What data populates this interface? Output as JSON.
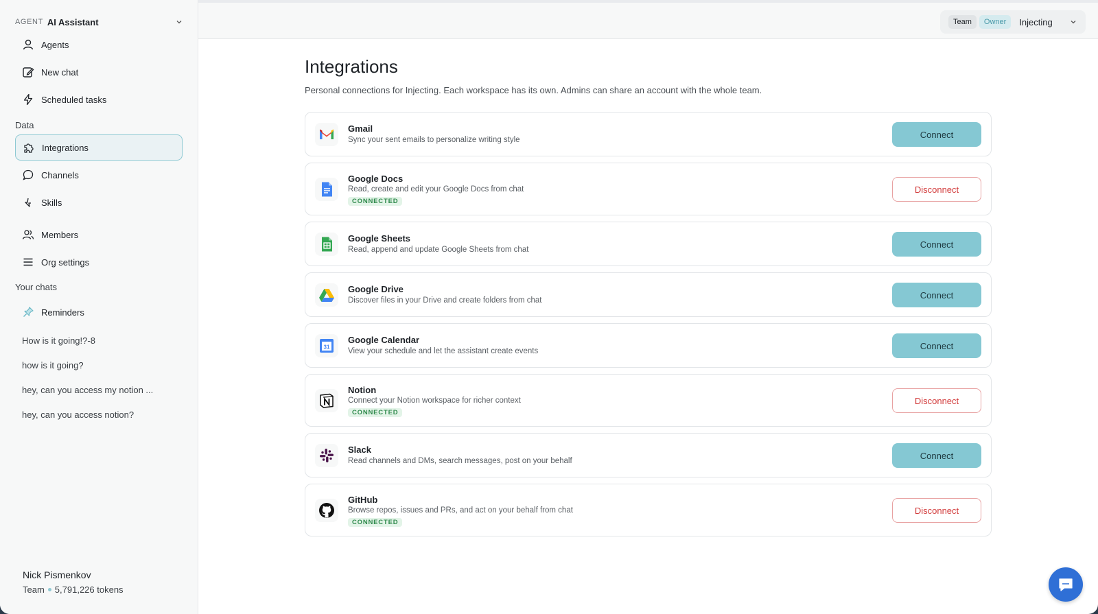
{
  "sidebar": {
    "agent_tag": "AGENT",
    "agent_name": "AI Assistant",
    "nav_top": [
      {
        "label": "Agents",
        "icon": "user-icon"
      },
      {
        "label": "New chat",
        "icon": "edit-icon"
      },
      {
        "label": "Scheduled tasks",
        "icon": "lightning-icon"
      }
    ],
    "data_label": "Data",
    "nav_data": [
      {
        "label": "Integrations",
        "icon": "puzzle-icon",
        "active": true
      },
      {
        "label": "Channels",
        "icon": "chat-bubble-icon"
      },
      {
        "label": "Skills",
        "icon": "sparkle-icon"
      }
    ],
    "nav_org": [
      {
        "label": "Members",
        "icon": "users-icon"
      },
      {
        "label": "Org settings",
        "icon": "menu-icon"
      }
    ],
    "chats_label": "Your chats",
    "reminders_label": "Reminders",
    "chats": [
      "How is it going!?-8",
      "how is it going?",
      "hey, can you access my notion ...",
      "hey, can you access notion?"
    ],
    "user": {
      "name": "Nick Pismenkov",
      "plan": "Team",
      "tokens": "5,791,226 tokens"
    }
  },
  "topbar": {
    "team_pill": "Team",
    "owner_pill": "Owner",
    "workspace": "Injecting"
  },
  "main": {
    "title": "Integrations",
    "description": "Personal connections for Injecting. Each workspace has its own. Admins can share an account with the whole team.",
    "connected_label": "CONNECTED",
    "integrations": [
      {
        "name": "Gmail",
        "desc": "Sync your sent emails to personalize writing style",
        "connected": false,
        "action": "Connect",
        "icon": "gmail-icon"
      },
      {
        "name": "Google Docs",
        "desc": "Read, create and edit your Google Docs from chat",
        "connected": true,
        "action": "Disconnect",
        "icon": "google-docs-icon"
      },
      {
        "name": "Google Sheets",
        "desc": "Read, append and update Google Sheets from chat",
        "connected": false,
        "action": "Connect",
        "icon": "google-sheets-icon"
      },
      {
        "name": "Google Drive",
        "desc": "Discover files in your Drive and create folders from chat",
        "connected": false,
        "action": "Connect",
        "icon": "google-drive-icon"
      },
      {
        "name": "Google Calendar",
        "desc": "View your schedule and let the assistant create events",
        "connected": false,
        "action": "Connect",
        "icon": "google-calendar-icon"
      },
      {
        "name": "Notion",
        "desc": "Connect your Notion workspace for richer context",
        "connected": true,
        "action": "Disconnect",
        "icon": "notion-icon"
      },
      {
        "name": "Slack",
        "desc": "Read channels and DMs, search messages, post on your behalf",
        "connected": false,
        "action": "Connect",
        "icon": "slack-icon"
      },
      {
        "name": "GitHub",
        "desc": "Browse repos, issues and PRs, and act on your behalf from chat",
        "connected": true,
        "action": "Disconnect",
        "icon": "github-icon"
      }
    ]
  },
  "colors": {
    "accent": "#85c8d3",
    "danger": "#d23b3b",
    "connected": "#2f8a4c"
  }
}
